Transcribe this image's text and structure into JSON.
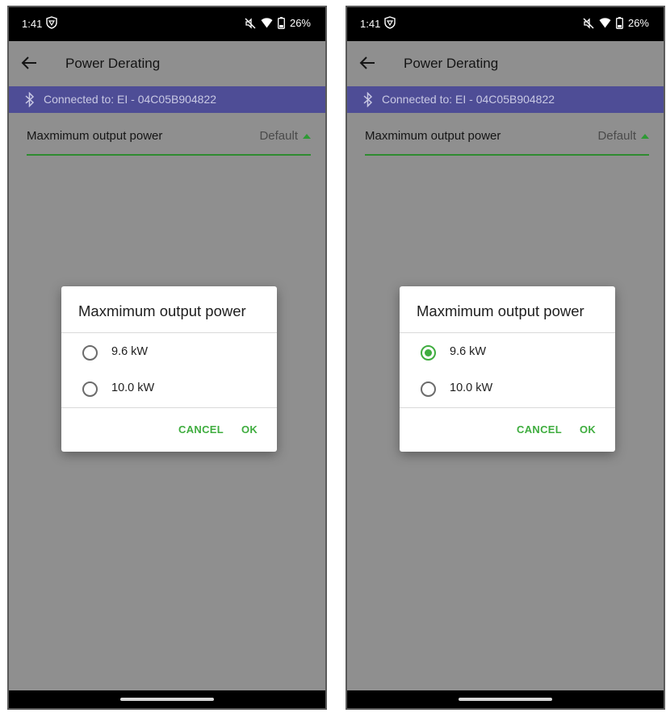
{
  "screens": [
    {
      "status": {
        "time": "1:41",
        "battery": "26%"
      },
      "app_bar": {
        "title": "Power Derating"
      },
      "connection": {
        "text": "Connected to: EI - 04C05B904822"
      },
      "setting": {
        "label": "Maxmimum output power",
        "value": "Default"
      },
      "dialog": {
        "title": "Maxmimum output power",
        "options": [
          {
            "label": "9.6 kW",
            "selected": false
          },
          {
            "label": "10.0 kW",
            "selected": false
          }
        ],
        "cancel": "CANCEL",
        "ok": "OK"
      }
    },
    {
      "status": {
        "time": "1:41",
        "battery": "26%"
      },
      "app_bar": {
        "title": "Power Derating"
      },
      "connection": {
        "text": "Connected to: EI - 04C05B904822"
      },
      "setting": {
        "label": "Maxmimum output power",
        "value": "Default"
      },
      "dialog": {
        "title": "Maxmimum output power",
        "options": [
          {
            "label": "9.6 kW",
            "selected": true
          },
          {
            "label": "10.0 kW",
            "selected": false
          }
        ],
        "cancel": "CANCEL",
        "ok": "OK"
      }
    }
  ],
  "colors": {
    "scrim": "#8f8f8f",
    "connection_bar": "#4e4d96",
    "accent": "#3fad3f",
    "underline": "#2e8b30"
  },
  "icons": [
    "vpn-key-icon",
    "mute-icon",
    "wifi-icon",
    "battery-icon",
    "back-arrow-icon",
    "bluetooth-icon",
    "dropdown-caret-icon",
    "radio-icon"
  ]
}
